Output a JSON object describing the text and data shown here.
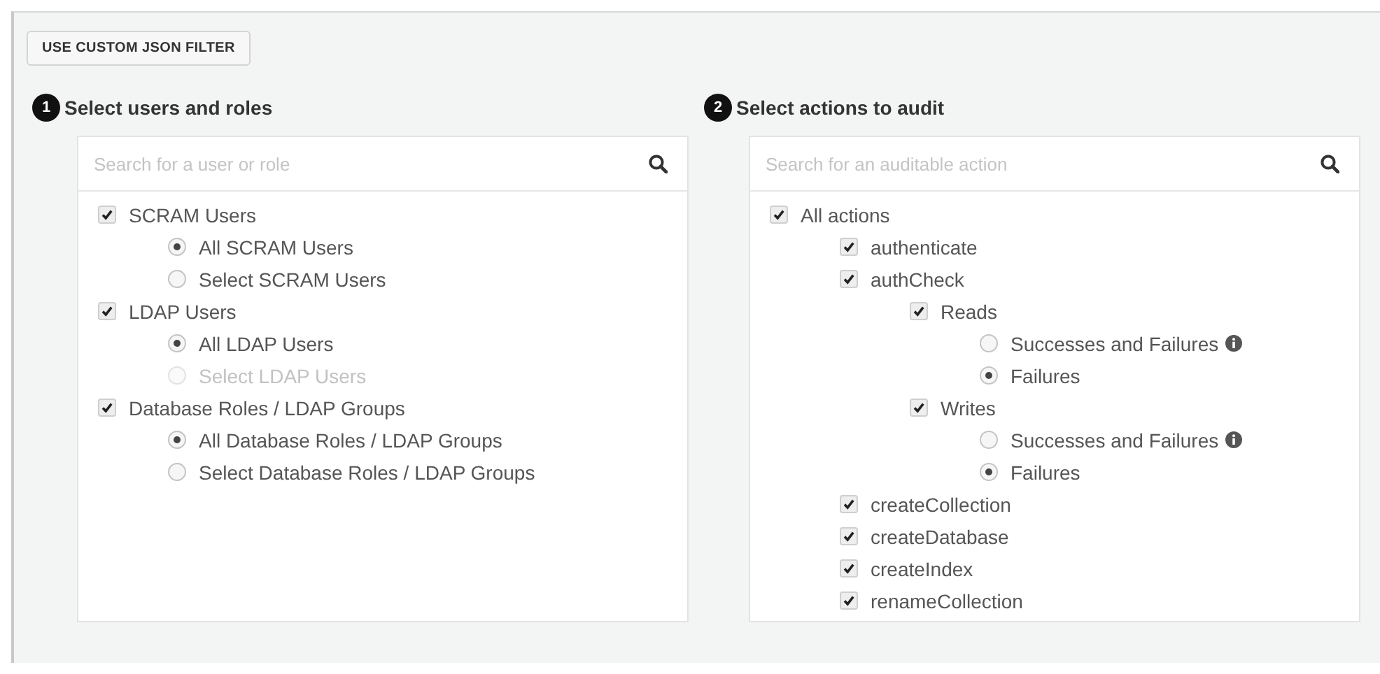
{
  "filter_button": "USE CUSTOM JSON FILTER",
  "sections": [
    {
      "step": "1",
      "title": "Select users and roles",
      "search": {
        "placeholder": "Search for a user or role"
      },
      "items": [
        {
          "label": "SCRAM Users",
          "kind": "checkbox",
          "checked": true,
          "children": [
            {
              "label": "All SCRAM Users",
              "kind": "radio",
              "selected": true,
              "disabled": false,
              "info": false
            },
            {
              "label": "Select SCRAM Users",
              "kind": "radio",
              "selected": false,
              "disabled": false,
              "info": false
            }
          ]
        },
        {
          "label": "LDAP Users",
          "kind": "checkbox",
          "checked": true,
          "children": [
            {
              "label": "All LDAP Users",
              "kind": "radio",
              "selected": true,
              "disabled": false,
              "info": false
            },
            {
              "label": "Select LDAP Users",
              "kind": "radio",
              "selected": false,
              "disabled": true,
              "info": false
            }
          ]
        },
        {
          "label": "Database Roles / LDAP Groups",
          "kind": "checkbox",
          "checked": true,
          "children": [
            {
              "label": "All Database Roles / LDAP Groups",
              "kind": "radio",
              "selected": true,
              "disabled": false,
              "info": false
            },
            {
              "label": "Select Database Roles / LDAP Groups",
              "kind": "radio",
              "selected": false,
              "disabled": false,
              "info": false
            }
          ]
        }
      ]
    },
    {
      "step": "2",
      "title": "Select actions to audit",
      "search": {
        "placeholder": "Search for an auditable action"
      },
      "items": [
        {
          "label": "All actions",
          "kind": "checkbox",
          "checked": true,
          "children": [
            {
              "label": "authenticate",
              "kind": "checkbox",
              "checked": true
            },
            {
              "label": "authCheck",
              "kind": "checkbox",
              "checked": true,
              "children": [
                {
                  "label": "Reads",
                  "kind": "checkbox",
                  "checked": true,
                  "children": [
                    {
                      "label": "Successes and Failures",
                      "kind": "radio",
                      "selected": false,
                      "disabled": false,
                      "info": true
                    },
                    {
                      "label": "Failures",
                      "kind": "radio",
                      "selected": true,
                      "disabled": false,
                      "info": false
                    }
                  ]
                },
                {
                  "label": "Writes",
                  "kind": "checkbox",
                  "checked": true,
                  "children": [
                    {
                      "label": "Successes and Failures",
                      "kind": "radio",
                      "selected": false,
                      "disabled": false,
                      "info": true
                    },
                    {
                      "label": "Failures",
                      "kind": "radio",
                      "selected": true,
                      "disabled": false,
                      "info": false
                    }
                  ]
                }
              ]
            },
            {
              "label": "createCollection",
              "kind": "checkbox",
              "checked": true
            },
            {
              "label": "createDatabase",
              "kind": "checkbox",
              "checked": true
            },
            {
              "label": "createIndex",
              "kind": "checkbox",
              "checked": true
            },
            {
              "label": "renameCollection",
              "kind": "checkbox",
              "checked": true
            }
          ]
        }
      ]
    }
  ]
}
